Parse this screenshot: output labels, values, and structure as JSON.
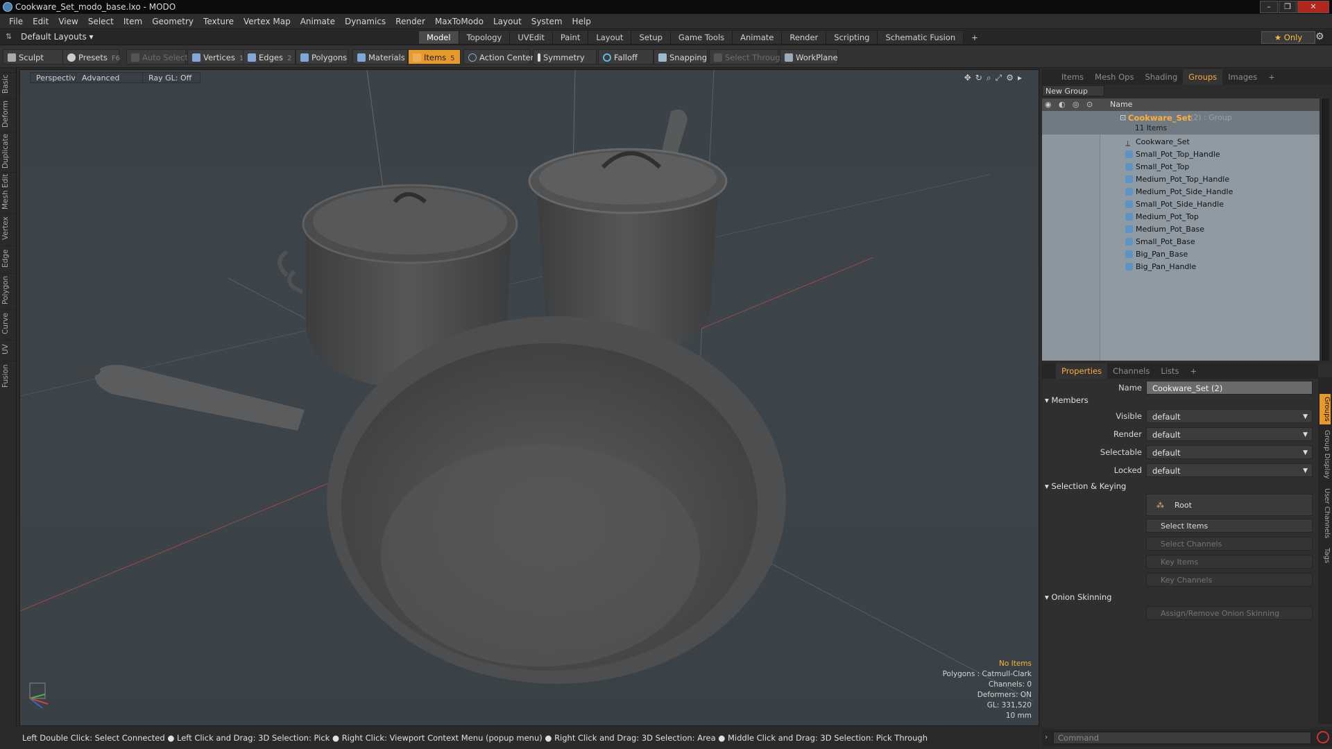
{
  "window": {
    "title": "Cookware_Set_modo_base.lxo - MODO"
  },
  "menu": [
    "File",
    "Edit",
    "View",
    "Select",
    "Item",
    "Geometry",
    "Texture",
    "Vertex Map",
    "Animate",
    "Dynamics",
    "Render",
    "MaxToModo",
    "Layout",
    "System",
    "Help"
  ],
  "layoutbar": {
    "layout_select": "Default Layouts ▾",
    "tabs": [
      "Model",
      "Topology",
      "UVEdit",
      "Paint",
      "Layout",
      "Setup",
      "Game Tools",
      "Animate",
      "Render",
      "Scripting",
      "Schematic Fusion",
      "+"
    ],
    "active_tab": "Model",
    "only_button": "★ Only"
  },
  "toolbar": {
    "sculpt": "Sculpt",
    "presets": "Presets",
    "presets_key": "F6",
    "auto_select": "Auto Select",
    "vertices": "Vertices",
    "vertices_count": "1",
    "edges": "Edges",
    "edges_count": "2",
    "polygons": "Polygons",
    "materials": "Materials",
    "items": "Items",
    "items_count": "5",
    "action_center": "Action Center",
    "symmetry": "Symmetry",
    "falloff": "Falloff",
    "snapping": "Snapping",
    "select_through": "Select Through",
    "workplane": "WorkPlane"
  },
  "left_tabs": [
    "Basic",
    "Deform",
    "Duplicate",
    "Mesh Edit",
    "Vertex",
    "Edge",
    "Polygon",
    "Curve",
    "UV",
    "Fusion"
  ],
  "viewport": {
    "perspective": "Perspective",
    "advanced": "Advanced",
    "raygl": "Ray GL: Off",
    "info": {
      "selection": "No Items",
      "polygons": "Polygons : Catmull-Clark",
      "channels": "Channels: 0",
      "deformers": "Deformers: ON",
      "gl": "GL: 331,520",
      "scale": "10 mm"
    }
  },
  "statusbar": {
    "text": "Left Double Click: Select Connected ● Left Click and Drag: 3D Selection: Pick ● Right Click: Viewport Context Menu (popup menu) ● Right Click and Drag: 3D Selection: Area ● Middle Click and Drag: 3D Selection: Pick Through"
  },
  "groups_panel": {
    "tabs": [
      "Items",
      "Mesh Ops",
      "Shading",
      "Groups",
      "Images",
      "+"
    ],
    "active_tab": "Groups",
    "new_group": "New Group",
    "column_name": "Name",
    "group": {
      "name": "Cookware_Set",
      "suffix": "(2) : Group",
      "count": "11 Items"
    },
    "items": [
      "Cookware_Set",
      "Small_Pot_Top_Handle",
      "Small_Pot_Top",
      "Medium_Pot_Top_Handle",
      "Medium_Pot_Side_Handle",
      "Small_Pot_Side_Handle",
      "Medium_Pot_Top",
      "Medium_Pot_Base",
      "Small_Pot_Base",
      "Big_Pan_Base",
      "Big_Pan_Handle"
    ]
  },
  "properties_panel": {
    "tabs": [
      "Properties",
      "Channels",
      "Lists",
      "+"
    ],
    "active_tab": "Properties",
    "name_label": "Name",
    "name_value": "Cookware_Set (2)",
    "members_section": "Members",
    "visible_label": "Visible",
    "visible_value": "default",
    "render_label": "Render",
    "render_value": "default",
    "selectable_label": "Selectable",
    "selectable_value": "default",
    "locked_label": "Locked",
    "locked_value": "default",
    "sel_keying_section": "Selection & Keying",
    "root_button": "Root",
    "select_items": "Select Items",
    "select_channels": "Select Channels",
    "key_items": "Key Items",
    "key_channels": "Key Channels",
    "onion_section": "Onion Skinning",
    "onion_button": "Assign/Remove Onion Skinning",
    "side_tabs": [
      "Groups",
      "Group Display",
      "User Channels",
      "Tags"
    ]
  },
  "command": {
    "placeholder": "Command"
  },
  "colors": {
    "accent": "#e79a2c",
    "group_name": "#ffae3a",
    "warn": "#ffb23a"
  }
}
